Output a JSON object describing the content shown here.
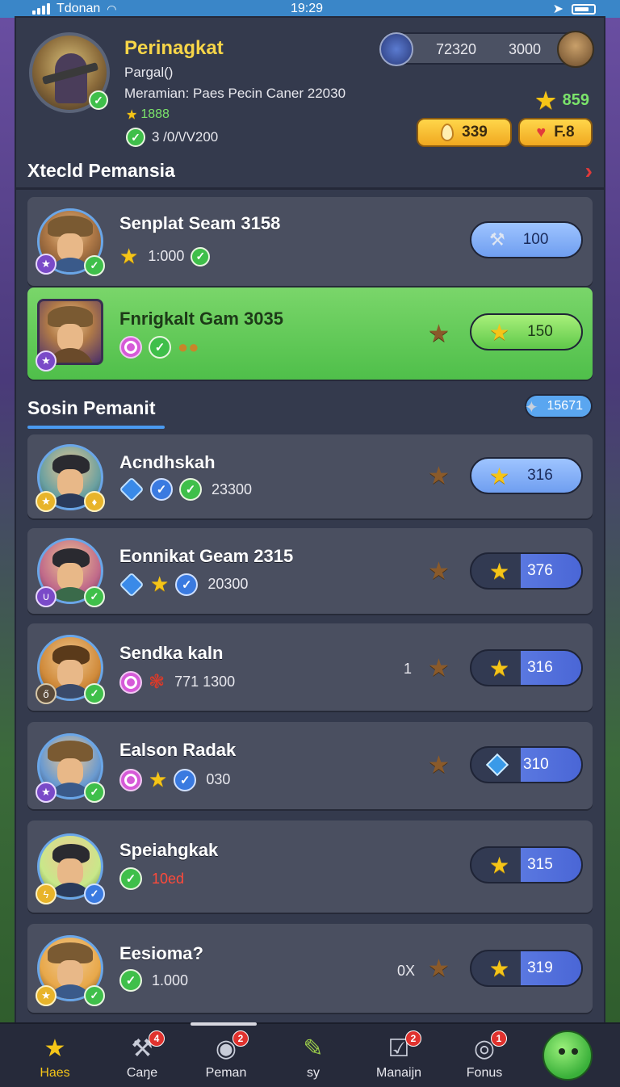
{
  "status": {
    "carrier": "Tdonan",
    "time": "19:29"
  },
  "profile": {
    "name": "Perinagkat",
    "subtitle": "Pargal()",
    "meta": "Meramian: Paes Pecin Caner 22030",
    "score": "1888",
    "progress": "3 /0/\\/V200",
    "currency_a": "72320",
    "currency_b": "3000",
    "stars": "859",
    "resource_a": "339",
    "resource_b": "F.8"
  },
  "section1": {
    "title": "Xtecld Pemansia",
    "cards": [
      {
        "name": "Senplat Seam 3158",
        "value": "1:000",
        "button": "100"
      },
      {
        "name": "Fnrigkalt Gam 3035",
        "button": "150"
      }
    ]
  },
  "section2": {
    "title": "Sosin Pemanit",
    "pill": "15671",
    "cards": [
      {
        "name": "Acndhskah",
        "value": "23300",
        "button": "316"
      },
      {
        "name": "Eonnikat Geam 2315",
        "value": "20300",
        "button": "376"
      },
      {
        "name": "Sendka kaln",
        "value": "771 1300",
        "side": "1",
        "button": "316"
      },
      {
        "name": "Ealson Radak",
        "value": "030",
        "button": "310"
      },
      {
        "name": "Speiahgkak",
        "value": "10ed",
        "button": "315"
      },
      {
        "name": "Eesioma?",
        "value": "1.000",
        "side": "0X",
        "button": "319"
      }
    ]
  },
  "tabs": [
    {
      "label": "Haes",
      "active": true
    },
    {
      "label": "Caŋe",
      "badge": "4"
    },
    {
      "label": "Peman",
      "badge": "2"
    },
    {
      "label": "sy"
    },
    {
      "label": "Manaijn",
      "badge": "2"
    },
    {
      "label": "Fonus",
      "badge": "1"
    }
  ],
  "colors": {
    "accent": "#f5c518",
    "highlight": "#5fc84a",
    "panel": "#343a4d",
    "status_bar": "#3a86c8"
  }
}
